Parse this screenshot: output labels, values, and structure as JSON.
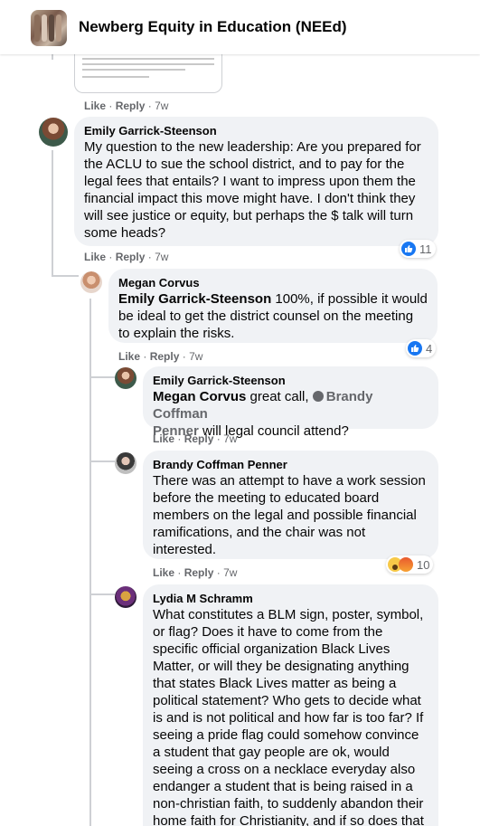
{
  "group": {
    "title": "Newberg Equity in Education (NEEd)"
  },
  "actions": {
    "like": "Like",
    "reply": "Reply",
    "sep": "·"
  },
  "comments": [
    {
      "author": "Emily Garrick-Steenson",
      "text": [
        "My question to the new leadership: Are you prepared for",
        "the ACLU to sue the school district, and to pay for the",
        "legal fees that entails? I want to impress upon them the",
        "financial impact this move might have. I don't think they",
        "will see justice or equity, but perhaps the $ talk will turn",
        "some heads?"
      ],
      "time": "7w",
      "reaction_count": "11"
    },
    {
      "author": "Megan Corvus",
      "mention": "Emily Garrick-Steenson",
      "text": [
        " 100%, if possible it would",
        "be ideal to get the district counsel on the meeting",
        "to explain the risks."
      ],
      "time": "7w",
      "reaction_count": "4"
    },
    {
      "author": "Emily Garrick-Steenson",
      "mention": "Megan Corvus",
      "text_a": " great call, ",
      "mention2_a": "Brandy Coffman",
      "mention2_b": "Penner",
      "text_b": " will legal council attend?",
      "time": "7w"
    },
    {
      "author": "Brandy Coffman Penner",
      "text": [
        "There was an attempt to have a work session",
        "before the meeting to educated board",
        "members on the legal and possible financial",
        "ramifications, and the chair was not",
        "interested."
      ],
      "time": "7w",
      "reaction_count": "10"
    },
    {
      "author": "Lydia M Schramm",
      "text": [
        "What constitutes a BLM sign, poster, symbol,",
        "or flag? Does it have to come from the",
        "specific official organization Black Lives",
        "Matter, or will they be designating anything",
        "that states Black Lives matter as being a",
        "political statement? Who gets to decide what",
        "is and is not political and how far is too far? If",
        "seeing a pride flag could somehow convince",
        "a student that gay people are ok, would",
        "seeing a cross on a necklace everyday also",
        "endanger a student that is being raised in a",
        "non-christian faith, to suddenly abandon their",
        "home faith for Christianity, and if so does that"
      ]
    }
  ]
}
